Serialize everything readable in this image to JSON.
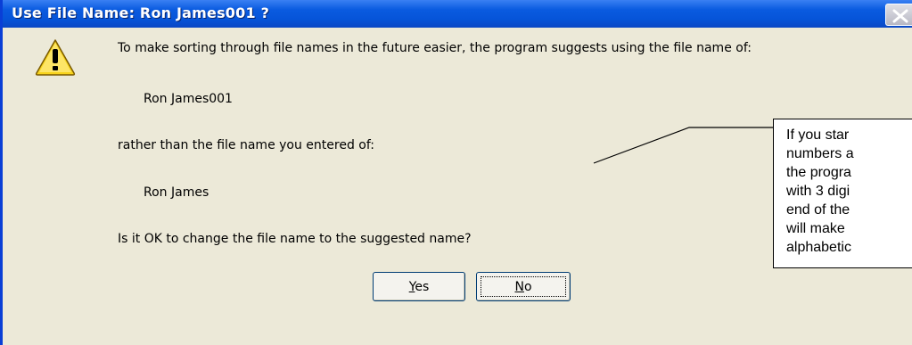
{
  "window": {
    "title": "Use File Name: Ron James001 ?"
  },
  "icons": {
    "warning": "warning-icon",
    "close": "close-icon"
  },
  "message": {
    "intro": "To make sorting through file names in the future easier, the program suggests using the file name of:",
    "suggested_name": "Ron James001",
    "rather_than": "rather than the file name you entered of:",
    "entered_name": "Ron James",
    "question": "Is it OK to change the file name to the suggested name?"
  },
  "buttons": {
    "yes": {
      "mnemonic": "Y",
      "rest": "es"
    },
    "no": {
      "mnemonic": "N",
      "rest": "o"
    }
  },
  "callout": {
    "lines": [
      "If you star",
      "numbers a",
      "the progra",
      "with 3 digi",
      "end of the",
      "will make",
      "alphabetic"
    ]
  },
  "colors": {
    "titlebar": "#0654d8",
    "dialog_bg": "#ece9d8",
    "warning_fill": "#f7d31c"
  }
}
